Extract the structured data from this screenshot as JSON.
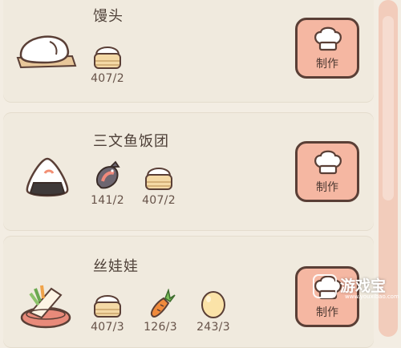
{
  "recipes": [
    {
      "name": "馒头",
      "make_label": "制作",
      "ingredients": [
        {
          "icon": "steamed-bun-basket-icon",
          "qty": "407/2"
        }
      ]
    },
    {
      "name": "三文鱼饭团",
      "make_label": "制作",
      "ingredients": [
        {
          "icon": "salmon-icon",
          "qty": "141/2"
        },
        {
          "icon": "steamed-bun-basket-icon",
          "qty": "407/2"
        }
      ]
    },
    {
      "name": "丝娃娃",
      "make_label": "制作",
      "ingredients": [
        {
          "icon": "steamed-bun-basket-icon",
          "qty": "407/3"
        },
        {
          "icon": "carrot-icon",
          "qty": "126/3"
        },
        {
          "icon": "egg-icon",
          "qty": "243/3"
        }
      ]
    }
  ],
  "watermark": {
    "text": "游戏宝",
    "sub": "www.youxibao.com"
  },
  "colors": {
    "card": "#f0eade",
    "button": "#f5b7a2",
    "outline": "#5a3f36",
    "scrollbar": "#f2ccbb"
  }
}
